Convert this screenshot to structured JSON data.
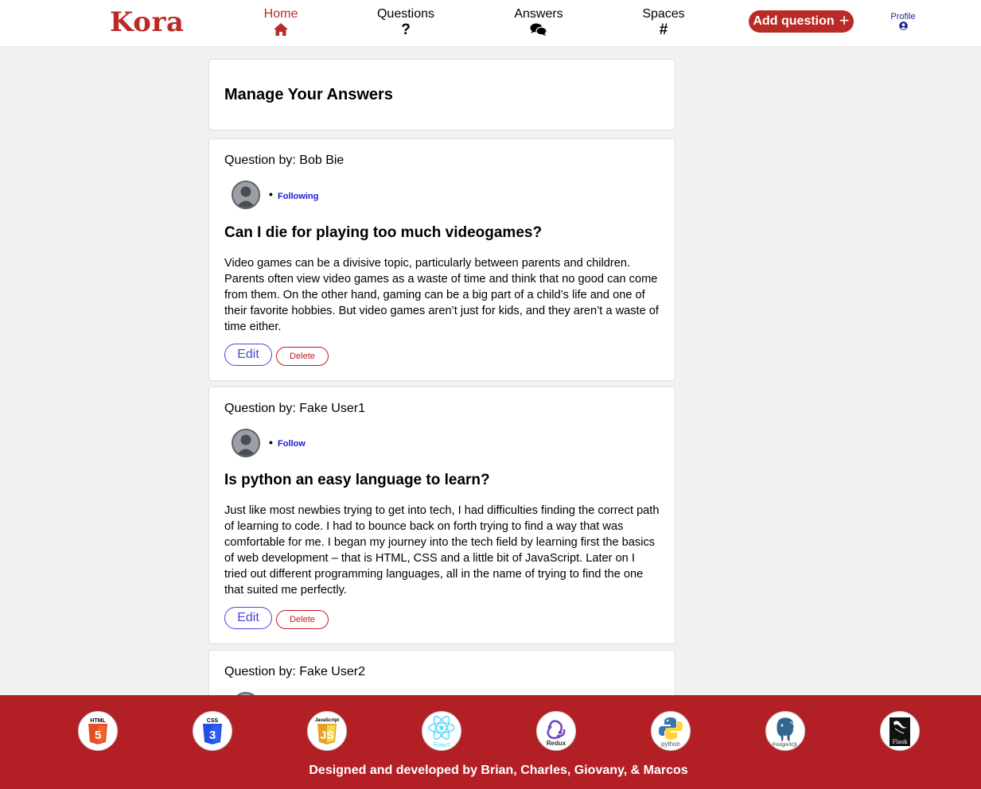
{
  "brand": {
    "name": "Kora",
    "color": "#b92b27"
  },
  "nav": {
    "items": [
      {
        "label": "Home",
        "icon": "home-icon",
        "active": true
      },
      {
        "label": "Questions",
        "icon": "question-mark-icon",
        "glyph": "?"
      },
      {
        "label": "Answers",
        "icon": "comments-icon"
      },
      {
        "label": "Spaces",
        "icon": "hashtag-icon",
        "glyph": "#"
      }
    ],
    "add_question": {
      "label": "Add question",
      "icon": "plus-icon"
    },
    "profile": {
      "label": "Profile",
      "icon": "user-circle-icon"
    }
  },
  "page": {
    "title": "Manage Your Answers"
  },
  "answers": [
    {
      "asked_by_prefix": "Question by:",
      "asked_by": "Bob Bie",
      "follow_label": "Following",
      "question": "Can I die for playing too much videogames?",
      "answer": "Video games can be a divisive topic, particularly between parents and children. Parents often view video games as a waste of time and think that no good can come from them. On the other hand, gaming can be a big part of a child’s life and one of their favorite hobbies. But video games aren’t just for kids, and they aren’t a waste of time either.",
      "edit_label": "Edit",
      "delete_label": "Delete"
    },
    {
      "asked_by_prefix": "Question by:",
      "asked_by": "Fake User1",
      "follow_label": "Follow",
      "question": "Is python an easy language to learn?",
      "answer": "Just like most newbies trying to get into tech, I had difficulties finding the correct path of learning to code. I had to bounce back on forth trying to find a way that was comfortable for me. I began my journey into the tech field by learning first the basics of web development – that is HTML, CSS and a little bit of JavaScript. Later on I tried out different programming languages, all in the name of trying to find the one that suited me perfectly.",
      "edit_label": "Edit",
      "delete_label": "Delete"
    },
    {
      "asked_by_prefix": "Question by:",
      "asked_by": "Fake User2"
    }
  ],
  "footer": {
    "technologies": [
      {
        "name": "HTML5",
        "icon": "html5-logo-icon",
        "color": "#e44d26"
      },
      {
        "name": "CSS3",
        "icon": "css3-logo-icon",
        "color": "#264de4"
      },
      {
        "name": "JavaScript",
        "icon": "javascript-logo-icon",
        "color": "#f0db4f"
      },
      {
        "name": "React",
        "icon": "react-logo-icon",
        "color": "#61dafb"
      },
      {
        "name": "Redux",
        "icon": "redux-logo-icon",
        "color": "#764abc"
      },
      {
        "name": "python",
        "icon": "python-logo-icon",
        "color": "#3776ab"
      },
      {
        "name": "PostgreSQL",
        "icon": "postgresql-logo-icon",
        "color": "#336791"
      },
      {
        "name": "Flask",
        "icon": "flask-logo-icon",
        "color": "#000000"
      }
    ],
    "credits": "Designed and developed by Brian, Charles, Giovany, & Marcos",
    "background": "#b22026"
  }
}
